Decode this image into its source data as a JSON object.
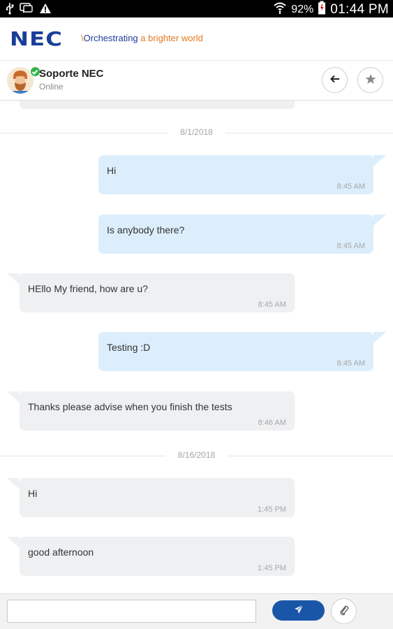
{
  "status_bar": {
    "battery_percent": "92%",
    "time": "01:44 PM"
  },
  "brand": {
    "logo_text": "NEC",
    "tagline_slash": "\\",
    "tagline_part1": "Orchestrating",
    "tagline_part2": " a brighter world"
  },
  "contact": {
    "name": "Soporte NEC",
    "status": "Online"
  },
  "dates": [
    "8/1/2018",
    "8/16/2018"
  ],
  "messages": [
    {
      "direction": "out",
      "text": "Hi",
      "time": "8:45 AM"
    },
    {
      "direction": "out",
      "text": "Is anybody there?",
      "time": "8:45 AM"
    },
    {
      "direction": "in",
      "text": "HEllo My friend, how are u?",
      "time": "8:45 AM"
    },
    {
      "direction": "out",
      "text": "Testing :D",
      "time": "8:45 AM"
    },
    {
      "direction": "in",
      "text": "Thanks please advise when you finish the tests",
      "time": "8:46 AM"
    },
    {
      "direction": "in",
      "text": "Hi",
      "time": "1:45 PM"
    },
    {
      "direction": "in",
      "text": "good afternoon",
      "time": "1:45 PM"
    }
  ],
  "composer": {
    "input_value": "",
    "input_placeholder": ""
  },
  "icons": {
    "usb": "usb-icon",
    "chat": "chat-notification-icon",
    "warning": "warning-icon",
    "wifi": "wifi-icon",
    "battery": "battery-icon",
    "back": "arrow-left-icon",
    "favorite": "star-icon",
    "send": "paper-plane-icon",
    "attach": "paperclip-icon"
  },
  "colors": {
    "brand_blue": "#1a3e9a",
    "brand_orange": "#e3781f",
    "outgoing_bubble": "#dceefc",
    "incoming_bubble": "#eff0f2",
    "send_button": "#1a56a8",
    "presence": "#36b34a"
  }
}
